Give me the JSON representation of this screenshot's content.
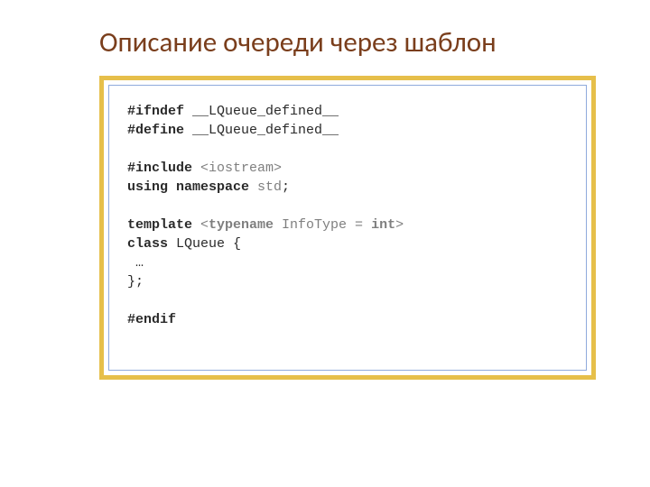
{
  "title": "Описание очереди через шаблон",
  "code": {
    "ifndef_kw": "#ifndef",
    "ifndef_sym": " __LQueue_defined__",
    "define_kw": "#define",
    "define_sym": " __LQueue_defined__",
    "include_kw": "#include",
    "include_open": " <",
    "include_hdr": "iostream",
    "include_close": ">",
    "using_kw": "using",
    "namespace_kw": " namespace",
    "ns_name": " std",
    "semicolon1": ";",
    "template_kw": "template",
    "tpl_open": " <",
    "typename_kw": "typename",
    "infotype": " InfoType = ",
    "int_kw": "int",
    "tpl_close": ">",
    "class_kw": "class",
    "class_name": " LQueue {",
    "ellipsis": " …",
    "closebrace": "};",
    "endif_kw": "#endif"
  }
}
